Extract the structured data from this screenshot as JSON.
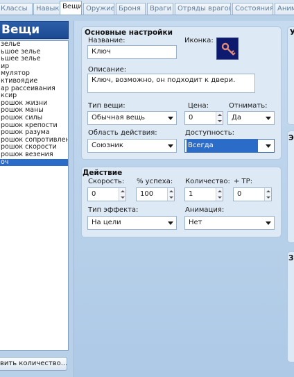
{
  "tabs": [
    {
      "label": "Классы",
      "active": false
    },
    {
      "label": "Навыки",
      "active": false
    },
    {
      "label": "Вещи",
      "active": true
    },
    {
      "label": "Оружие",
      "active": false
    },
    {
      "label": "Броня",
      "active": false
    },
    {
      "label": "Враги",
      "active": false
    },
    {
      "label": "Отряды врагов",
      "active": false
    },
    {
      "label": "Состояния",
      "active": false
    },
    {
      "label": "Анимации",
      "active": false
    }
  ],
  "list": {
    "header": "Вещи",
    "items": [
      "зелье",
      "ьшое зелье",
      "ьшее зелье",
      "ир",
      "мулятор",
      "ктивоядие",
      "ар рассеивания",
      "ксир",
      "рошок жизни",
      "рошок маны",
      "рошок силы",
      "рошок крепости",
      "рошок разума",
      "рошок сопротивления",
      "рошок скорости",
      "рошок везения",
      "оч"
    ],
    "selected_index": 16,
    "change_button": "вить количество..."
  },
  "basic": {
    "title": "Основные настройки",
    "name_label": "Название:",
    "name_value": "Ключ",
    "icon_label": "Иконка:",
    "icon_name": "key-icon",
    "description_label": "Описание:",
    "description_value": "Ключ, возможно, он подходит к двери.",
    "item_type_label": "Тип вещи:",
    "item_type_value": "Обычная вещь",
    "price_label": "Цена:",
    "price_value": "0",
    "consumable_label": "Отнимать:",
    "consumable_value": "Да",
    "scope_label": "Область действия:",
    "scope_value": "Союзник",
    "occasion_label": "Доступность:",
    "occasion_value": "Всегда"
  },
  "invocation": {
    "title": "Действие",
    "speed_label": "Скорость:",
    "speed_value": "0",
    "success_label": "% успеха:",
    "success_value": "100",
    "repeat_label": "Количество:",
    "repeat_value": "1",
    "tp_label": "+ TP:",
    "tp_value": "0",
    "hit_type_label": "Тип эффекта:",
    "hit_type_value": "На цели",
    "animation_label": "Анимация:",
    "animation_value": "Нет"
  },
  "right_panels": {
    "top_title": "У",
    "middle_title": "Э",
    "bottom_title": "З"
  },
  "colors": {
    "accent": "#2a6cc8",
    "header_blue": "#1b4a92",
    "panel_bg": "#dde9f5",
    "icon_bg": "#0d1a6e",
    "key_color": "#e08a7a"
  }
}
